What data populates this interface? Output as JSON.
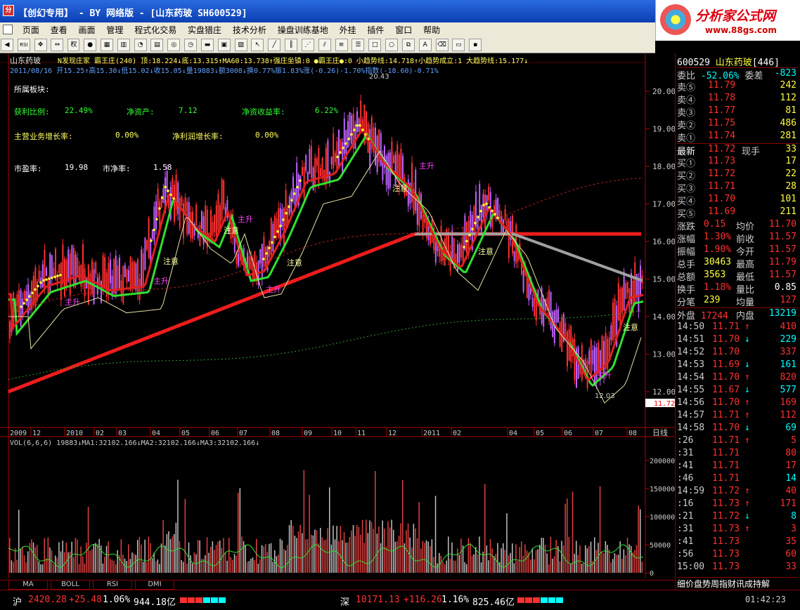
{
  "window": {
    "title": "【创幻专用】 - BY 网络版 - [山东药玻 SH600529]",
    "brand_name": "分析家公式网",
    "brand_url": "www.88gs.com"
  },
  "menu": [
    "页面",
    "查看",
    "画面",
    "管理",
    "程式化交易",
    "实盘猎庄",
    "技术分析",
    "操盘训练基地",
    "外挂",
    "插件",
    "窗口",
    "帮助"
  ],
  "toolbar": {
    "quan_label": "权"
  },
  "chart": {
    "stock_name": "山东药玻",
    "indicator_line": "N发现庄家  霸王庄(240) 顶:18.224↓底:13.315↑MA60:13.738↑强庄坐镇:0 ●霸王庄●:0 小趋势线:14.718↑小趋势成立:1 大趋势线:15.177↓",
    "ohlc_line": "2011/08/16 开15.25↑高15.30↓低15.02↓收15.05↓量19883↓额3008↓换0.77%振1.83%涨(-0.26)-1.70%指数(-18.60)-0.71%",
    "fin_sector": "所属板块:",
    "fin_rows": [
      {
        "l1": "获利比例:",
        "v1": "22.49%",
        "l2": "净资产:",
        "v2": "7.12",
        "l3": "净资收益率:",
        "v3": "6.22%"
      },
      {
        "l1": "主营业务增长率:",
        "v1": "0.00%",
        "l2": "净利润增长率:",
        "v2": "0.00%"
      },
      {
        "l1": "市盈率:",
        "v1": "19.98",
        "l2": "市净率:",
        "v2": "1.58"
      }
    ],
    "price_axis": [
      "20.00",
      "19.00",
      "18.00",
      "17.00",
      "16.00",
      "15.00",
      "14.00",
      "13.00",
      "12.00"
    ],
    "current_price_tag": "11.72",
    "high_label": "20.43",
    "low_label": "12.03",
    "time_axis": [
      "2009",
      "12",
      "2010",
      "02",
      "03",
      "04",
      "05",
      "06",
      "07",
      "08",
      "09",
      "10",
      "11",
      "12",
      "2011",
      "02",
      "04",
      "05",
      "06",
      "07",
      "08"
    ],
    "period_label": "日线",
    "annotations": [
      "注意",
      "主升",
      "注意",
      "注意",
      "主升",
      "注意",
      "主升",
      "注意",
      "主升",
      "注意",
      "主升",
      "主升"
    ],
    "vol_line": "VOL(6,6,6) 19883↓MA1:32102.166↓MA2:32102.166↓MA3:32102.166↓",
    "vol_axis": [
      "200000",
      "150000",
      "100000",
      "50000",
      "0"
    ],
    "tabs": [
      "MA",
      "BOLL",
      "RSI",
      "DMI"
    ],
    "colors": {
      "up": "#ff3030",
      "down": "#00ffff",
      "ma_green": "#30e030",
      "ma_red": "#ee1c1c",
      "ma_gray": "#a0a0a0"
    }
  },
  "quote": {
    "code": "600529",
    "name": "山东药玻",
    "rank": "[446]",
    "webi_label": "委比",
    "webi_value": "-52.06%",
    "weicha_label": "委差",
    "weicha_value": "-823",
    "asks": [
      {
        "label": "卖⑤",
        "price": "11.79",
        "vol": "242"
      },
      {
        "label": "卖④",
        "price": "11.78",
        "vol": "112"
      },
      {
        "label": "卖③",
        "price": "11.77",
        "vol": "81"
      },
      {
        "label": "卖②",
        "price": "11.75",
        "vol": "486"
      },
      {
        "label": "卖①",
        "price": "11.74",
        "vol": "281"
      }
    ],
    "last_label": "最新",
    "last_price": "11.72",
    "cur_label": "现手",
    "cur_vol": "33",
    "bids": [
      {
        "label": "买①",
        "price": "11.73",
        "vol": "17"
      },
      {
        "label": "买②",
        "price": "11.72",
        "vol": "22"
      },
      {
        "label": "买③",
        "price": "11.71",
        "vol": "28"
      },
      {
        "label": "买④",
        "price": "11.70",
        "vol": "101"
      },
      {
        "label": "买⑤",
        "price": "11.69",
        "vol": "211"
      }
    ],
    "stats": [
      {
        "l1": "涨跌",
        "v1": "0.15",
        "l2": "均价",
        "v2": "11.70"
      },
      {
        "l1": "涨幅",
        "v1": "1.30%",
        "l2": "前收",
        "v2": "11.57"
      },
      {
        "l1": "振幅",
        "v1": "1.90%",
        "l2": "今开",
        "v2": "11.57"
      },
      {
        "l1": "总手",
        "v1": "30463",
        "l2": "最高",
        "v2": "11.79"
      },
      {
        "l1": "总额",
        "v1": "3563",
        "l2": "最低",
        "v2": "11.57"
      },
      {
        "l1": "换手",
        "v1": "1.18%",
        "l2": "量比",
        "v2": "0.85"
      },
      {
        "l1": "分笔",
        "v1": "239",
        "l2": "均量",
        "v2": "127"
      }
    ],
    "outer_label": "外盘",
    "outer_value": "17244",
    "inner_label": "内盘",
    "inner_value": "13219",
    "ticks": [
      {
        "t": "14:50",
        "p": "11.71",
        "a": "↑",
        "v": "410",
        "c": "up"
      },
      {
        "t": "14:51",
        "p": "11.70",
        "a": "↓",
        "v": "229",
        "c": "dn"
      },
      {
        "t": "14:52",
        "p": "11.70",
        "a": "",
        "v": "337",
        "c": "up"
      },
      {
        "t": "14:53",
        "p": "11.69",
        "a": "↓",
        "v": "161",
        "c": "dn"
      },
      {
        "t": "14:54",
        "p": "11.70",
        "a": "↑",
        "v": "820",
        "c": "up"
      },
      {
        "t": "14:55",
        "p": "11.67",
        "a": "↓",
        "v": "577",
        "c": "dn"
      },
      {
        "t": "14:56",
        "p": "11.70",
        "a": "↑",
        "v": "169",
        "c": "up"
      },
      {
        "t": "14:57",
        "p": "11.71",
        "a": "↑",
        "v": "112",
        "c": "up"
      },
      {
        "t": "14:58",
        "p": "11.70",
        "a": "↓",
        "v": "69",
        "c": "dn"
      },
      {
        "t": ":26",
        "p": "11.71",
        "a": "↑",
        "v": "5",
        "c": "up"
      },
      {
        "t": ":31",
        "p": "11.71",
        "a": "",
        "v": "80",
        "c": "up"
      },
      {
        "t": ":41",
        "p": "11.71",
        "a": "",
        "v": "17",
        "c": "up"
      },
      {
        "t": ":46",
        "p": "11.71",
        "a": "",
        "v": "14",
        "c": "dn"
      },
      {
        "t": "14:59",
        "p": "11.72",
        "a": "↑",
        "v": "40",
        "c": "up"
      },
      {
        "t": ":16",
        "p": "11.73",
        "a": "↑",
        "v": "171",
        "c": "up"
      },
      {
        "t": ":21",
        "p": "11.72",
        "a": "↓",
        "v": "8",
        "c": "dn"
      },
      {
        "t": ":31",
        "p": "11.73",
        "a": "↑",
        "v": "3",
        "c": "up"
      },
      {
        "t": ":41",
        "p": "11.73",
        "a": "",
        "v": "35",
        "c": "up"
      },
      {
        "t": ":56",
        "p": "11.73",
        "a": "",
        "v": "60",
        "c": "up"
      },
      {
        "t": "15:00",
        "p": "11.73",
        "a": "",
        "v": "33",
        "c": "up"
      }
    ],
    "footer_tabs": "细价盘势周指财讯成持解"
  },
  "status": {
    "sh_label": "沪",
    "sh_index": "2420.28",
    "sh_change": "+25.48",
    "sh_pct": "1.06%",
    "sh_amount": "944.18亿",
    "sz_label": "深",
    "sz_index": "10171.13",
    "sz_change": "+116.26",
    "sz_pct": "1.16%",
    "sz_amount": "825.46亿",
    "clock": "01:42:23"
  }
}
